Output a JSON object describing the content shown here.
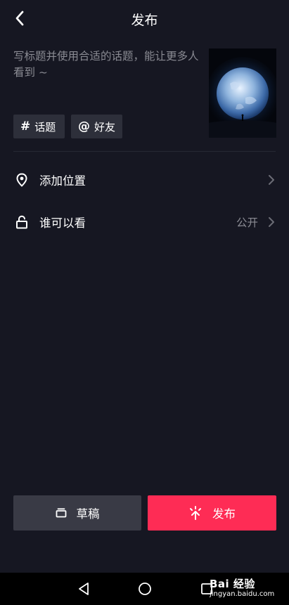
{
  "header": {
    "title": "发布",
    "back_icon": "chevron-left-icon"
  },
  "caption": {
    "placeholder": "写标题并使用合适的话题，能让更多人看到 ~"
  },
  "chips": {
    "topic": {
      "symbol": "#",
      "label": "话题"
    },
    "friend": {
      "symbol": "@",
      "label": "好友"
    }
  },
  "rows": {
    "location": {
      "icon": "location-pin-icon",
      "label": "添加位置"
    },
    "privacy": {
      "icon": "unlock-icon",
      "label": "谁可以看",
      "value": "公开"
    }
  },
  "actions": {
    "draft": {
      "icon": "draft-box-icon",
      "label": "草稿"
    },
    "publish": {
      "icon": "sparkle-icon",
      "label": "发布"
    }
  },
  "watermark": {
    "main": "Bai 经验",
    "sub": "jingyan.baidu.com"
  },
  "colors": {
    "background": "#161722",
    "accent": "#fe2c55",
    "chip": "#2d2f3a",
    "muted_text": "#8a8b93"
  }
}
